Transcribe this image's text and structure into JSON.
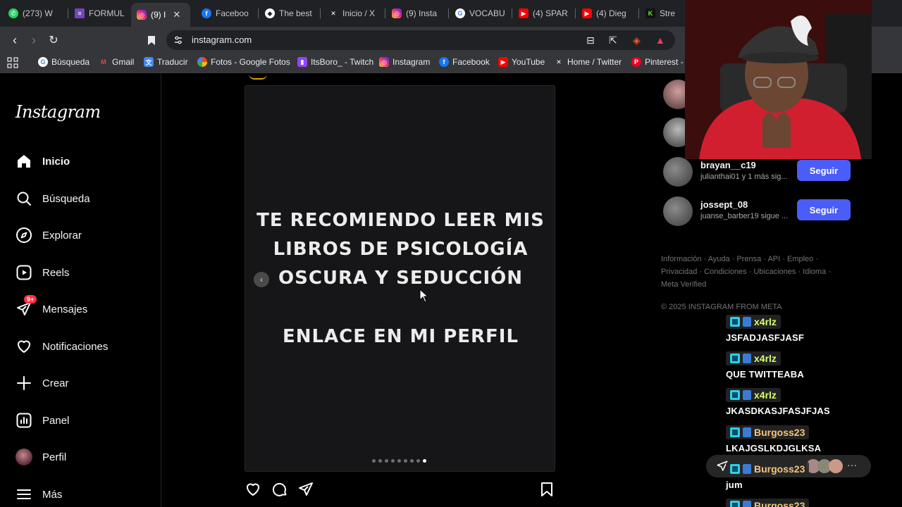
{
  "browser": {
    "tabs": [
      {
        "label": "(273) W",
        "icon": "whatsapp-icon",
        "color": "#25d366"
      },
      {
        "label": "FORMUL",
        "icon": "forms-icon",
        "color": "#7248b9"
      },
      {
        "label": "(9) I",
        "icon": "instagram-icon",
        "color": "#e1306c",
        "active": true
      },
      {
        "label": "Faceboo",
        "icon": "facebook-icon",
        "color": "#1877f2"
      },
      {
        "label": "The best",
        "icon": "diamond-icon",
        "color": "#ffffff"
      },
      {
        "label": "Inicio / X",
        "icon": "x-icon",
        "color": "#ffffff"
      },
      {
        "label": "(9) Insta",
        "icon": "instagram-icon",
        "color": "#e1306c"
      },
      {
        "label": "VOCABU",
        "icon": "google-icon",
        "color": "#4285f4"
      },
      {
        "label": "(4) SPAR",
        "icon": "youtube-icon",
        "color": "#ff0000"
      },
      {
        "label": "(4) Dieg",
        "icon": "youtube-icon",
        "color": "#ff0000"
      },
      {
        "label": "Stre",
        "icon": "kick-icon",
        "color": "#53fc18"
      }
    ],
    "url": "instagram.com",
    "bookmarks": [
      {
        "label": "Búsqueda",
        "icon": "google-icon",
        "color": "#4285f4"
      },
      {
        "label": "Gmail",
        "icon": "gmail-icon",
        "color": "#ea4335"
      },
      {
        "label": "Traducir",
        "icon": "translate-icon",
        "color": "#4285f4"
      },
      {
        "label": "Fotos - Google Fotos",
        "icon": "photos-icon",
        "color": "#fbbc04"
      },
      {
        "label": "ItsBoro_ - Twitch",
        "icon": "twitch-icon",
        "color": "#9146ff"
      },
      {
        "label": "Instagram",
        "icon": "instagram-icon",
        "color": "#e1306c"
      },
      {
        "label": "Facebook",
        "icon": "facebook-icon",
        "color": "#1877f2"
      },
      {
        "label": "YouTube",
        "icon": "youtube-icon",
        "color": "#ff0000"
      },
      {
        "label": "Home / Twitter",
        "icon": "x-icon",
        "color": "#ffffff"
      },
      {
        "label": "Pinterest - I",
        "icon": "pinterest-icon",
        "color": "#e60023"
      }
    ]
  },
  "instagram": {
    "logo": "Instagram",
    "nav": [
      {
        "label": "Inicio",
        "icon": "home-icon"
      },
      {
        "label": "Búsqueda",
        "icon": "search-icon"
      },
      {
        "label": "Explorar",
        "icon": "compass-icon"
      },
      {
        "label": "Reels",
        "icon": "reels-icon"
      },
      {
        "label": "Mensajes",
        "icon": "messenger-icon",
        "badge": "9+"
      },
      {
        "label": "Notificaciones",
        "icon": "heart-icon"
      },
      {
        "label": "Crear",
        "icon": "plus-icon"
      },
      {
        "label": "Panel",
        "icon": "chart-icon"
      },
      {
        "label": "Perfil",
        "icon": "avatar-icon"
      },
      {
        "label": "Más",
        "icon": "menu-icon"
      }
    ],
    "post": {
      "lines": [
        "TE RECOMIENDO LEER MIS",
        "LIBROS DE PSICOLOGÍA",
        "OSCURA Y SEDUCCIÓN",
        "ENLACE EN MI PERFIL"
      ],
      "carousel_count": 9,
      "carousel_active": 9
    },
    "suggestions": [
      {
        "username": "brayan__c19",
        "subtitle": "julianthai01 y 1 más sig...",
        "button": "Seguir"
      },
      {
        "username": "jossept_08",
        "subtitle": "juanse_barber19 sigue ...",
        "button": "Seguir"
      }
    ],
    "footer_links": [
      "Información",
      "Ayuda",
      "Prensa",
      "API",
      "Empleo",
      "Privacidad",
      "Condiciones",
      "Ubicaciones",
      "Idioma",
      "Meta Verified"
    ],
    "copyright": "© 2025 INSTAGRAM FROM META"
  },
  "chat": [
    {
      "user": "x4rlz",
      "color": "#d6ff6b",
      "text": "JSFADJASFJASF"
    },
    {
      "user": "x4rlz",
      "color": "#d6ff6b",
      "text": "QUE TWITTEABA"
    },
    {
      "user": "x4rlz",
      "color": "#d6ff6b",
      "text": "JKASDKASJFASJFJAS"
    },
    {
      "user": "Burgoss23",
      "color": "#f4c57a",
      "text": "LKAJGSLKDJGLKSA"
    },
    {
      "user": "Burgoss23",
      "color": "#f4c57a",
      "text": "jum"
    },
    {
      "user": "Burgoss23",
      "color": "#f4c57a",
      "text": ""
    }
  ]
}
